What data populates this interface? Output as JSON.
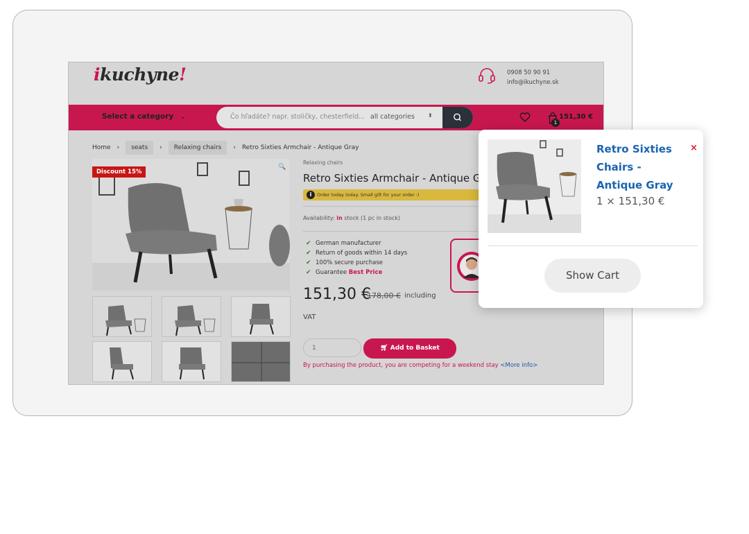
{
  "header": {
    "logo_prefix": "i",
    "logo_main": "kuchyne",
    "logo_suffix": "!",
    "phone": "0908 50 90 91",
    "email": "info@ikuchyne.sk"
  },
  "nav": {
    "category_label": "Select a category",
    "search_placeholder": "Čo hľadáte? napr. stoličky, chesterfield...",
    "search_category": "all categories",
    "cart_count": "1",
    "cart_total": "151,30 €"
  },
  "breadcrumbs": [
    "Home",
    "seats",
    "Relaxing chairs",
    "Retro Sixties Armchair - Antique Gray"
  ],
  "product": {
    "discount_badge": "Discount 15%",
    "category": "Relaxing chairs",
    "title": "Retro Sixties Armchair - Antique Gray",
    "promo": "Order today today. Small gift for your order :)",
    "availability_label": "Availability:",
    "availability_in": "in",
    "availability_rest": "stock (1 pc in stock)",
    "features": [
      "German manufacturer",
      "Return of goods within 14 days",
      "100% secure purchase"
    ],
    "guarantee_prefix": "Guarantee",
    "guarantee_highlight": "Best Price",
    "price": "151,30 €",
    "old_price": "178,00 €",
    "price_note": "including",
    "vat": "VAT",
    "quantity": "1",
    "add_button": "Add to Basket",
    "compete_text": "By purchasing the product, you are competing for a weekend stay",
    "more_info": "<More info>"
  },
  "popup": {
    "title": "Retro Sixties Chairs - Antique Gray",
    "close": "×",
    "qty_line": "1 × 151,30 €",
    "show_cart": "Show Cart"
  },
  "colors": {
    "brand": "#c8174f",
    "link": "#1a64b0",
    "close": "#e0192f"
  }
}
